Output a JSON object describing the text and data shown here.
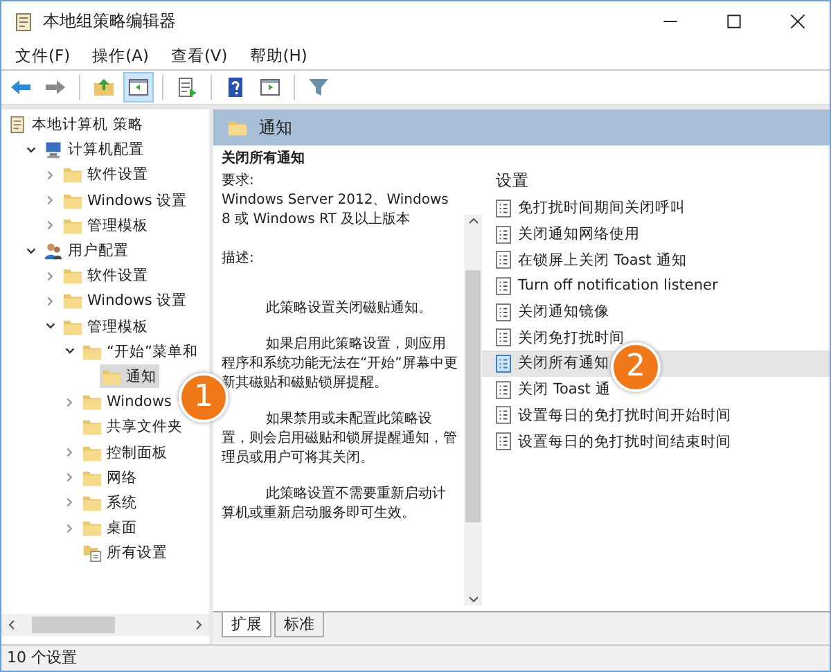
{
  "window": {
    "title": "本地组策略编辑器"
  },
  "menu": [
    "文件(F)",
    "操作(A)",
    "查看(V)",
    "帮助(H)"
  ],
  "toolbar": [
    {
      "kind": "back",
      "pressed": false
    },
    {
      "kind": "forward",
      "pressed": false
    },
    {
      "kind": "sep"
    },
    {
      "kind": "up",
      "pressed": false
    },
    {
      "kind": "tree",
      "pressed": true
    },
    {
      "kind": "sep"
    },
    {
      "kind": "export",
      "pressed": false
    },
    {
      "kind": "sep"
    },
    {
      "kind": "help",
      "pressed": false
    },
    {
      "kind": "pane",
      "pressed": false
    },
    {
      "kind": "sep"
    },
    {
      "kind": "filter",
      "pressed": false
    }
  ],
  "tree": [
    {
      "label": "本地计算机 策略",
      "kind": "policy",
      "selected": false,
      "children": [
        {
          "label": "计算机配置",
          "kind": "computer",
          "expanded": true,
          "selected": false,
          "children": [
            {
              "label": "软件设置",
              "kind": "folder",
              "expanded": false,
              "selected": false
            },
            {
              "label": "Windows 设置",
              "kind": "folder",
              "expanded": false,
              "selected": false
            },
            {
              "label": "管理模板",
              "kind": "folder",
              "expanded": false,
              "selected": false
            }
          ]
        },
        {
          "label": "用户配置",
          "kind": "users",
          "expanded": true,
          "selected": false,
          "children": [
            {
              "label": "软件设置",
              "kind": "folder",
              "expanded": false,
              "selected": false
            },
            {
              "label": "Windows 设置",
              "kind": "folder",
              "expanded": false,
              "selected": false
            },
            {
              "label": "管理模板",
              "kind": "folder",
              "expanded": true,
              "selected": false,
              "children": [
                {
                  "label": "“开始”菜单和",
                  "kind": "folder",
                  "expanded": true,
                  "selected": false,
                  "children": [
                    {
                      "label": "通知",
                      "kind": "folder",
                      "selected": true
                    }
                  ]
                },
                {
                  "label": "Windows",
                  "kind": "folder",
                  "expanded": false,
                  "selected": false
                },
                {
                  "label": "共享文件夹",
                  "kind": "folder",
                  "selected": false
                },
                {
                  "label": "控制面板",
                  "kind": "folder",
                  "expanded": false,
                  "selected": false
                },
                {
                  "label": "网络",
                  "kind": "folder",
                  "expanded": false,
                  "selected": false
                },
                {
                  "label": "系统",
                  "kind": "folder",
                  "expanded": false,
                  "selected": false
                },
                {
                  "label": "桌面",
                  "kind": "folder",
                  "expanded": false,
                  "selected": false
                },
                {
                  "label": "所有设置",
                  "kind": "all-settings",
                  "selected": false
                }
              ]
            }
          ]
        }
      ]
    }
  ],
  "header": {
    "title": "通知"
  },
  "description": {
    "title": "关闭所有通知",
    "requirement_label": "要求:",
    "requirement": "Windows Server 2012、Windows 8 或 Windows RT 及以上版本",
    "description_label": "描述:",
    "paragraphs": [
      "此策略设置关闭磁贴通知。",
      "如果启用此策略设置，则应用程序和系统功能无法在“开始”屏幕中更新其磁贴和磁贴锁屏提醒。",
      "如果禁用或未配置此策略设置，则会启用磁贴和锁屏提醒通知，管理员或用户可将其关闭。",
      "此策略设置不需要重新启动计算机或重新启动服务即可生效。"
    ]
  },
  "settings": {
    "column": "设置",
    "items": [
      {
        "label": "免打扰时间期间关闭呼叫",
        "selected": false
      },
      {
        "label": "关闭通知网络使用",
        "selected": false
      },
      {
        "label": "在锁屏上关闭 Toast 通知",
        "selected": false
      },
      {
        "label": "Turn off notification listener",
        "selected": false
      },
      {
        "label": "关闭通知镜像",
        "selected": false
      },
      {
        "label": "关闭免打扰时间",
        "selected": false
      },
      {
        "label": "关闭所有通知",
        "selected": true
      },
      {
        "label": "关闭 Toast 通",
        "selected": false
      },
      {
        "label": "设置每日的免打扰时间开始时间",
        "selected": false
      },
      {
        "label": "设置每日的免打扰时间结束时间",
        "selected": false
      }
    ]
  },
  "tabs": [
    {
      "label": "扩展",
      "selected": true
    },
    {
      "label": "标准",
      "selected": false
    }
  ],
  "status_bar": "10 个设置",
  "callouts": [
    {
      "label": "1"
    },
    {
      "label": "2"
    }
  ]
}
